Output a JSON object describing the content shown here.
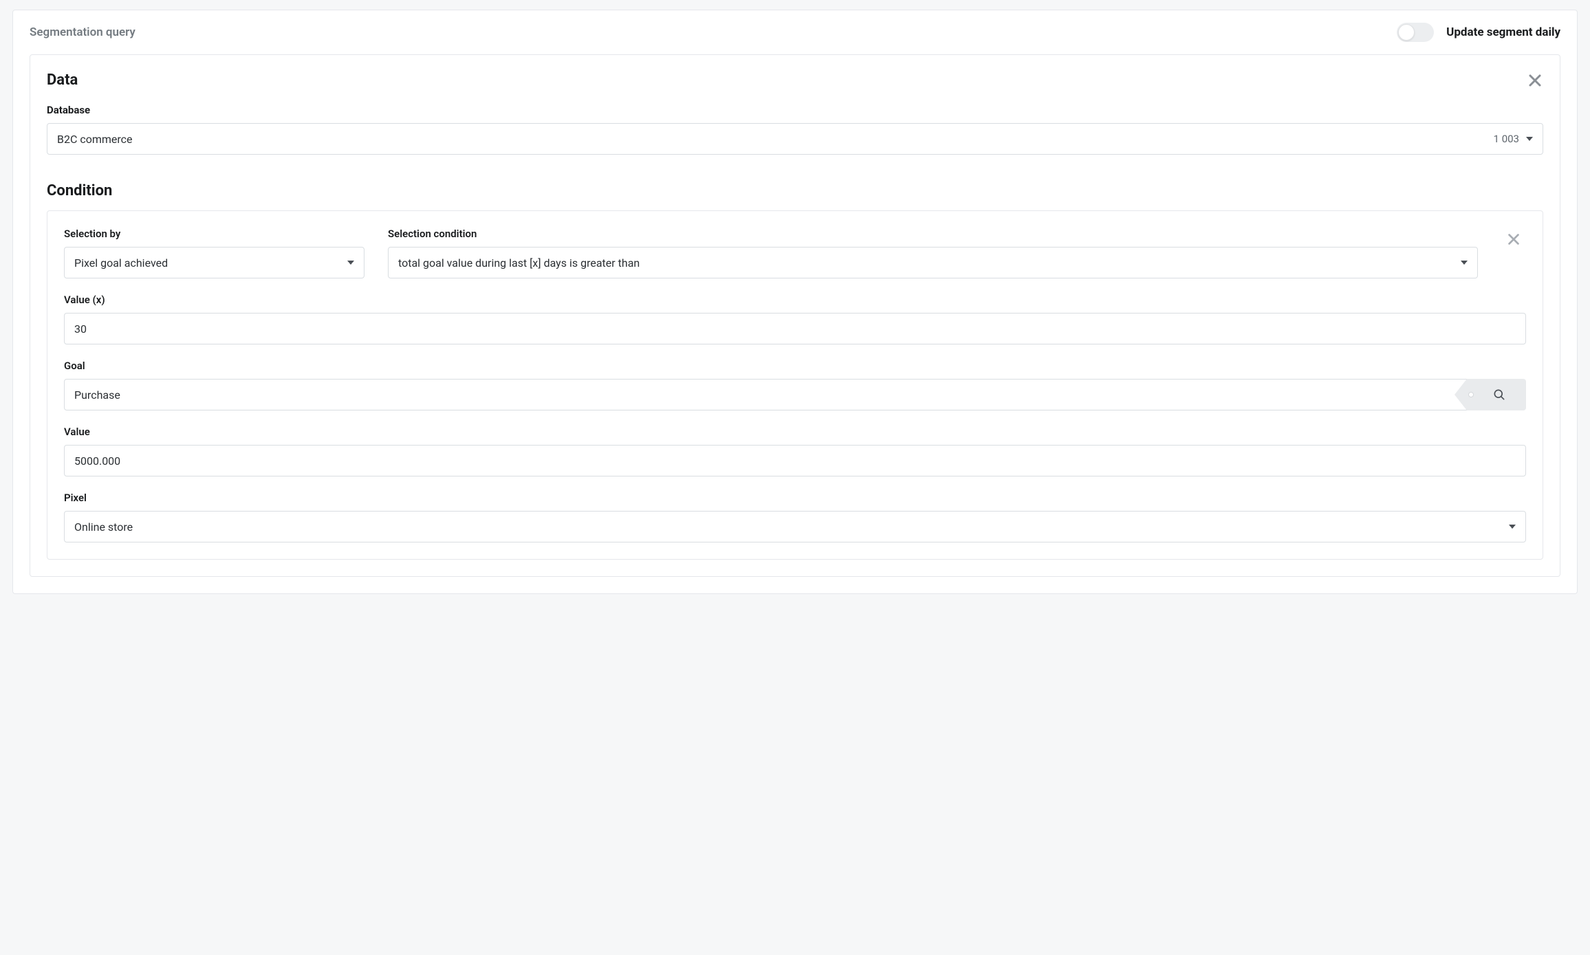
{
  "header": {
    "title": "Segmentation query",
    "toggle_label": "Update segment daily",
    "toggle_on": false
  },
  "data_panel": {
    "title": "Data",
    "database_label": "Database",
    "database_value": "B2C commerce",
    "database_count": "1 003"
  },
  "condition_panel": {
    "title": "Condition",
    "selection_by_label": "Selection by",
    "selection_by_value": "Pixel goal achieved",
    "selection_condition_label": "Selection condition",
    "selection_condition_value": "total goal value during last [x] days is greater than",
    "value_x_label": "Value (x)",
    "value_x_value": "30",
    "goal_label": "Goal",
    "goal_value": "Purchase",
    "value_label": "Value",
    "value_value": "5000.000",
    "pixel_label": "Pixel",
    "pixel_value": "Online store"
  }
}
